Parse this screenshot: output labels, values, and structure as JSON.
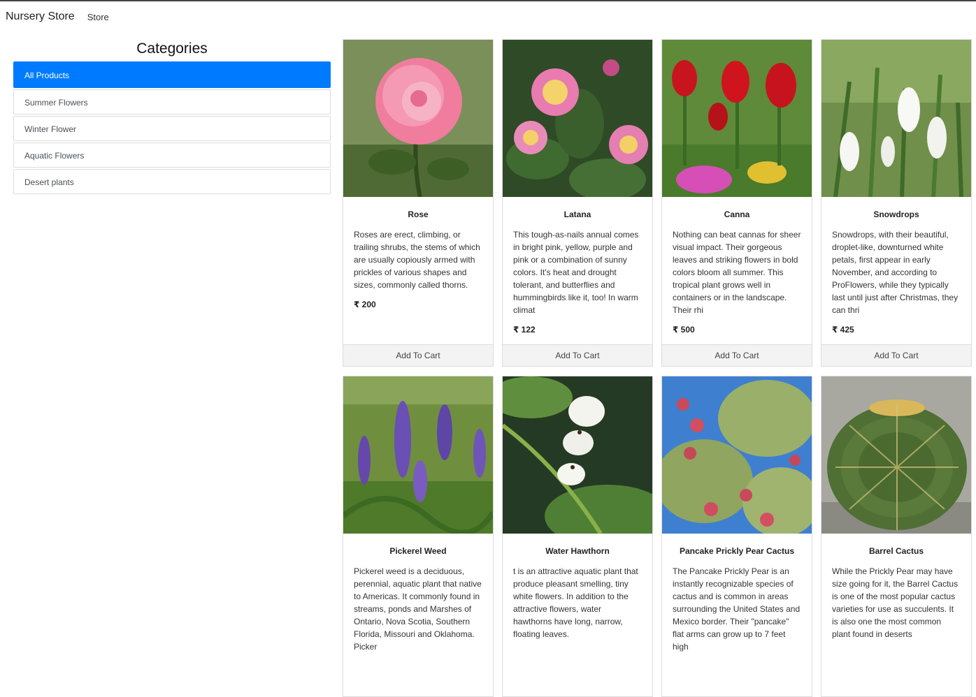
{
  "navbar": {
    "brand": "Nursery Store",
    "store_link": "Store"
  },
  "sidebar": {
    "heading": "Categories",
    "items": [
      {
        "label": "All Products",
        "active": true
      },
      {
        "label": "Summer Flowers",
        "active": false
      },
      {
        "label": "Winter Flower",
        "active": false
      },
      {
        "label": "Aquatic Flowers",
        "active": false
      },
      {
        "label": "Desert plants",
        "active": false
      }
    ]
  },
  "cart_button_label": "Add To Cart",
  "products": [
    {
      "name": "Rose",
      "description": "Roses are erect, climbing, or trailing shrubs, the stems of which are usually copiously armed with prickles of various shapes and sizes, commonly called thorns.",
      "price": "₹ 200",
      "image": "pink-rose-photo"
    },
    {
      "name": "Latana",
      "description": "This tough-as-nails annual comes in bright pink, yellow, purple and pink or a combination of sunny colors. It's heat and drought tolerant, and butterflies and hummingbirds like it, too! In warm climat",
      "price": "₹ 122",
      "image": "lantana-flowers-photo"
    },
    {
      "name": "Canna",
      "description": "Nothing can beat cannas for sheer visual impact. Their gorgeous leaves and striking flowers in bold colors bloom all summer. This tropical plant grows well in containers or in the landscape. Their rhi",
      "price": "₹ 500",
      "image": "red-canna-photo"
    },
    {
      "name": "Snowdrops",
      "description": "Snowdrops, with their beautiful, droplet-like, downturned white petals, first appear in early November, and according to ProFlowers, while they typically last until just after Christmas, they can thri",
      "price": "₹ 425",
      "image": "snowdrops-photo"
    },
    {
      "name": "Pickerel Weed",
      "description": "Pickerel weed is a deciduous, perennial, aquatic plant that native to Americas. It commonly found in streams, ponds and Marshes of Ontario, Nova Scotia, Southern Florida, Missouri and Oklahoma. Picker",
      "price": "",
      "image": "pickerel-weed-photo"
    },
    {
      "name": "Water Hawthorn",
      "description": "t is an attractive aquatic plant that produce pleasant smelling, tiny white flowers. In addition to the attractive flowers, water hawthorns have long, narrow, floating leaves.",
      "price": "",
      "image": "water-hawthorn-photo"
    },
    {
      "name": "Pancake Prickly Pear Cactus",
      "description": "The Pancake Prickly Pear is an instantly recognizable species of cactus and is common in areas surrounding the United States and Mexico border. Their \"pancake\" flat arms can grow up to 7 feet high",
      "price": "",
      "image": "prickly-pear-cactus-photo"
    },
    {
      "name": "Barrel Cactus",
      "description": "While the Prickly Pear may have size going for it, the Barrel Cactus is one of the most popular cactus varieties for use as succulents. It is also one the most common plant found in deserts",
      "price": "",
      "image": "barrel-cactus-photo"
    }
  ]
}
